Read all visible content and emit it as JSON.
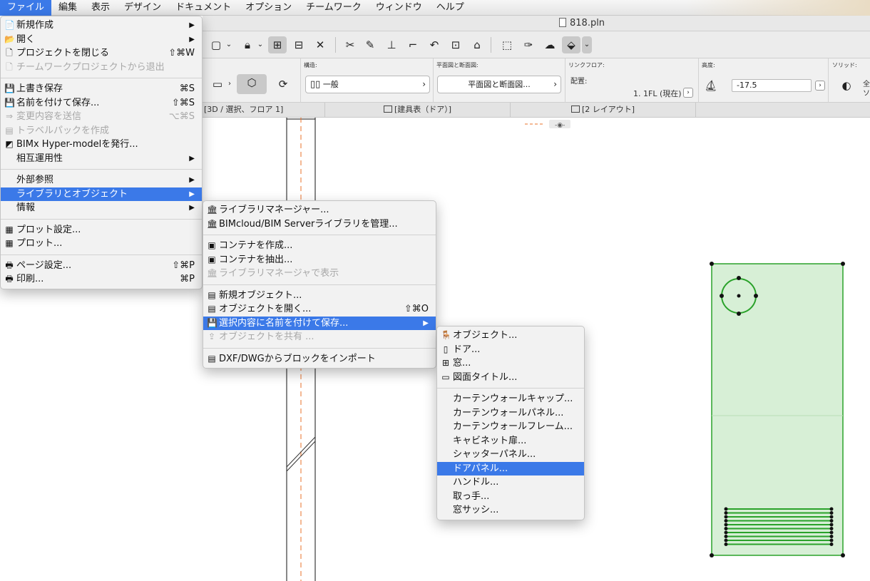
{
  "menubar": [
    "ファイル",
    "編集",
    "表示",
    "デザイン",
    "ドキュメント",
    "オプション",
    "チームワーク",
    "ウィンドウ",
    "ヘルプ"
  ],
  "window_title": "818.pln",
  "infobox": {
    "structure_label": "構造:",
    "structure_value": "一般",
    "plan_section_label": "平面図と断面図:",
    "plan_section_value": "平面図と断面図...",
    "link_floor_label": "リンクフロア:",
    "placement_label": "配置:",
    "floor_value": "1. 1FL (現在)",
    "height_label": "高度:",
    "height_value": "-17.5",
    "solid_label": "ソリッド:",
    "solid_value_1": "全",
    "solid_value_2": "ソ"
  },
  "tabs": [
    "[3D / 選択、フロア 1]",
    "[建具表（ドア）]",
    "[2 レイアウト]"
  ],
  "file_menu": [
    {
      "label": "新規作成",
      "icon": "new-doc-icon",
      "glyph": "📄",
      "arrow": true
    },
    {
      "label": "開く",
      "icon": "open-icon",
      "glyph": "📂",
      "arrow": true
    },
    {
      "label": "プロジェクトを閉じる",
      "icon": "close-project-icon",
      "glyph": "🗋",
      "shortcut": "⇧⌘W"
    },
    {
      "label": "チームワークプロジェクトから退出",
      "icon": "leave-teamwork-icon",
      "glyph": "🗋",
      "disabled": true
    },
    {
      "sep": true
    },
    {
      "label": "上書き保存",
      "icon": "save-icon",
      "glyph": "💾",
      "shortcut": "⌘S"
    },
    {
      "label": "名前を付けて保存...",
      "icon": "save-as-icon",
      "glyph": "💾",
      "shortcut": "⇧⌘S"
    },
    {
      "label": "変更内容を送信",
      "icon": "send-changes-icon",
      "glyph": "⇒",
      "shortcut": "⌥⌘S",
      "disabled": true
    },
    {
      "label": "トラベルパックを作成",
      "icon": "travel-pack-icon",
      "glyph": "▤",
      "disabled": true
    },
    {
      "label": "BIMx Hyper-modelを発行...",
      "icon": "bimx-icon",
      "glyph": "◩"
    },
    {
      "label": "相互運用性",
      "arrow": true
    },
    {
      "sep": true
    },
    {
      "label": "外部参照",
      "arrow": true
    },
    {
      "label": "ライブラリとオブジェクト",
      "arrow": true,
      "highlight": true
    },
    {
      "label": "情報",
      "arrow": true
    },
    {
      "sep": true
    },
    {
      "label": "プロット設定...",
      "icon": "plot-setup-icon",
      "glyph": "▦"
    },
    {
      "label": "プロット...",
      "icon": "plot-icon",
      "glyph": "▦"
    },
    {
      "sep": true
    },
    {
      "label": "ページ設定...",
      "icon": "page-setup-icon",
      "glyph": "🖶",
      "shortcut": "⇧⌘P"
    },
    {
      "label": "印刷...",
      "icon": "print-icon",
      "glyph": "🖶",
      "shortcut": "⌘P"
    }
  ],
  "library_menu": [
    {
      "label": "ライブラリマネージャー...",
      "icon": "library-manager-icon",
      "glyph": "🏛"
    },
    {
      "label": "BIMcloud/BIM Serverライブラリを管理...",
      "icon": "bim-server-icon",
      "glyph": "🏛"
    },
    {
      "sep": true
    },
    {
      "label": "コンテナを作成...",
      "icon": "create-container-icon",
      "glyph": "▣"
    },
    {
      "label": "コンテナを抽出...",
      "icon": "extract-container-icon",
      "glyph": "▣"
    },
    {
      "label": "ライブラリマネージャで表示",
      "icon": "show-in-library-icon",
      "glyph": "🏛",
      "disabled": true
    },
    {
      "sep": true
    },
    {
      "label": "新規オブジェクト...",
      "icon": "new-object-icon",
      "glyph": "▤"
    },
    {
      "label": "オブジェクトを開く...",
      "icon": "open-object-icon",
      "glyph": "▤",
      "shortcut": "⇧⌘O"
    },
    {
      "label": "選択内容に名前を付けて保存...",
      "icon": "save-selection-icon",
      "glyph": "💾",
      "arrow": true,
      "highlight": true
    },
    {
      "label": "オブジェクトを共有 ...",
      "icon": "share-object-icon",
      "glyph": "⇪",
      "disabled": true
    },
    {
      "sep": true
    },
    {
      "label": "DXF/DWGからブロックをインポート",
      "icon": "import-block-icon",
      "glyph": "▤"
    }
  ],
  "save_menu": [
    {
      "label": "オブジェクト...",
      "icon": "object-icon",
      "glyph": "🪑"
    },
    {
      "label": "ドア...",
      "icon": "door-icon",
      "glyph": "▯"
    },
    {
      "label": "窓...",
      "icon": "window-icon",
      "glyph": "⊞"
    },
    {
      "label": "図面タイトル...",
      "icon": "drawing-title-icon",
      "glyph": "▭"
    },
    {
      "sep": true
    },
    {
      "label": "カーテンウォールキャップ..."
    },
    {
      "label": "カーテンウォールパネル..."
    },
    {
      "label": "カーテンウォールフレーム..."
    },
    {
      "label": "キャビネット扉..."
    },
    {
      "label": "シャッターパネル..."
    },
    {
      "label": "ドアパネル...",
      "highlight": true
    },
    {
      "label": "ハンドル..."
    },
    {
      "label": "取っ手..."
    },
    {
      "label": "窓サッシ..."
    }
  ],
  "colors": {
    "highlight": "#3b79e8",
    "selection_fill": "#d7efd6",
    "selection_stroke": "#2aa22a",
    "axis_dash": "#e8702a"
  }
}
